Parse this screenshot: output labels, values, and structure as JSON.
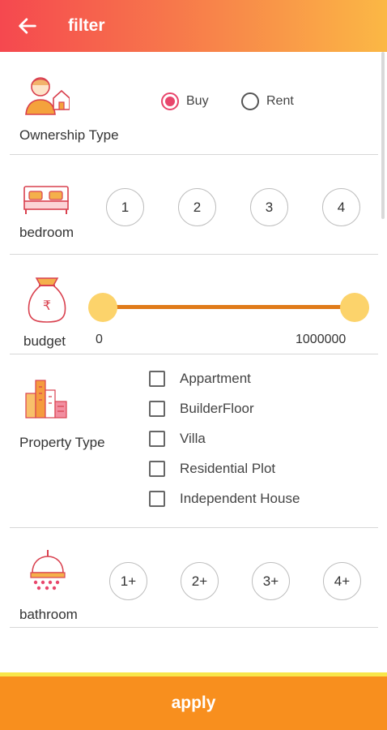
{
  "header": {
    "title": "filter",
    "back_icon": "arrow-left-icon"
  },
  "ownership": {
    "label": "Ownership Type",
    "options": [
      {
        "label": "Buy",
        "selected": true
      },
      {
        "label": "Rent",
        "selected": false
      }
    ],
    "icon": "person-house-icon"
  },
  "bedroom": {
    "label": "bedroom",
    "options": [
      "1",
      "2",
      "3",
      "4"
    ],
    "icon": "bed-icon"
  },
  "budget": {
    "label": "budget",
    "min_value": "0",
    "max_value": "1000000",
    "icon": "money-bag-icon",
    "currency_symbol": "₹"
  },
  "property": {
    "label": "Property Type",
    "options": [
      "Appartment",
      "BuilderFloor",
      "Villa",
      "Residential Plot",
      "Independent House"
    ],
    "icon": "buildings-icon"
  },
  "bathroom": {
    "label": "bathroom",
    "options": [
      "1+",
      "2+",
      "3+",
      "4+"
    ],
    "icon": "shower-icon"
  },
  "footer": {
    "apply_label": "apply"
  },
  "colors": {
    "accent": "#e8466c",
    "header_start": "#f5484f",
    "header_end": "#fbb845",
    "apply_bg": "#f88f1e",
    "slider": "#e07b1a",
    "thumb": "#fcd36b"
  }
}
